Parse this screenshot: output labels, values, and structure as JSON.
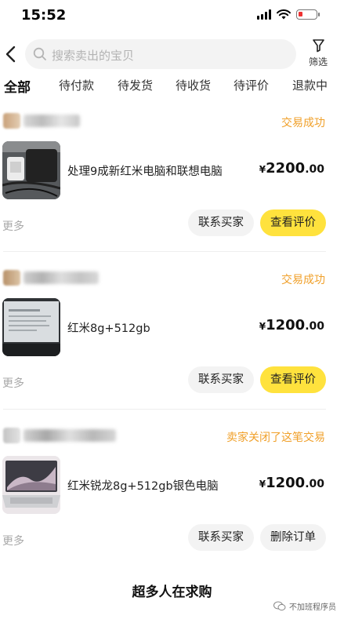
{
  "status_bar": {
    "time": "15:52"
  },
  "search": {
    "placeholder": "搜索卖出的宝贝"
  },
  "filter": {
    "label": "筛选"
  },
  "tabs": [
    "全部",
    "待付款",
    "待发货",
    "待收货",
    "待评价",
    "退款中"
  ],
  "active_tab": "全部",
  "orders": [
    {
      "status": "交易成功",
      "title": "处理9成新红米电脑和联想电脑",
      "currency": "¥",
      "price_int": "2200",
      "price_dec": ".00",
      "more": "更多",
      "buttons": [
        "联系买家",
        "查看评价"
      ]
    },
    {
      "status": "交易成功",
      "title": "红米8g+512gb",
      "currency": "¥",
      "price_int": "1200",
      "price_dec": ".00",
      "more": "更多",
      "buttons": [
        "联系买家",
        "查看评价"
      ]
    },
    {
      "status": "卖家关闭了这笔交易",
      "title": "红米锐龙8g+512gb银色电脑",
      "currency": "¥",
      "price_int": "1200",
      "price_dec": ".00",
      "more": "更多",
      "buttons": [
        "联系买家",
        "删除订单"
      ]
    }
  ],
  "promo": {
    "title": "超多人在求购"
  },
  "watermark": {
    "text": "不加班程序员"
  },
  "colors": {
    "accent_yellow": "#ffe23d",
    "status_orange": "#f0a02a"
  },
  "icons": [
    "back-icon",
    "search-icon",
    "filter-icon",
    "wifi-icon",
    "battery-icon"
  ]
}
